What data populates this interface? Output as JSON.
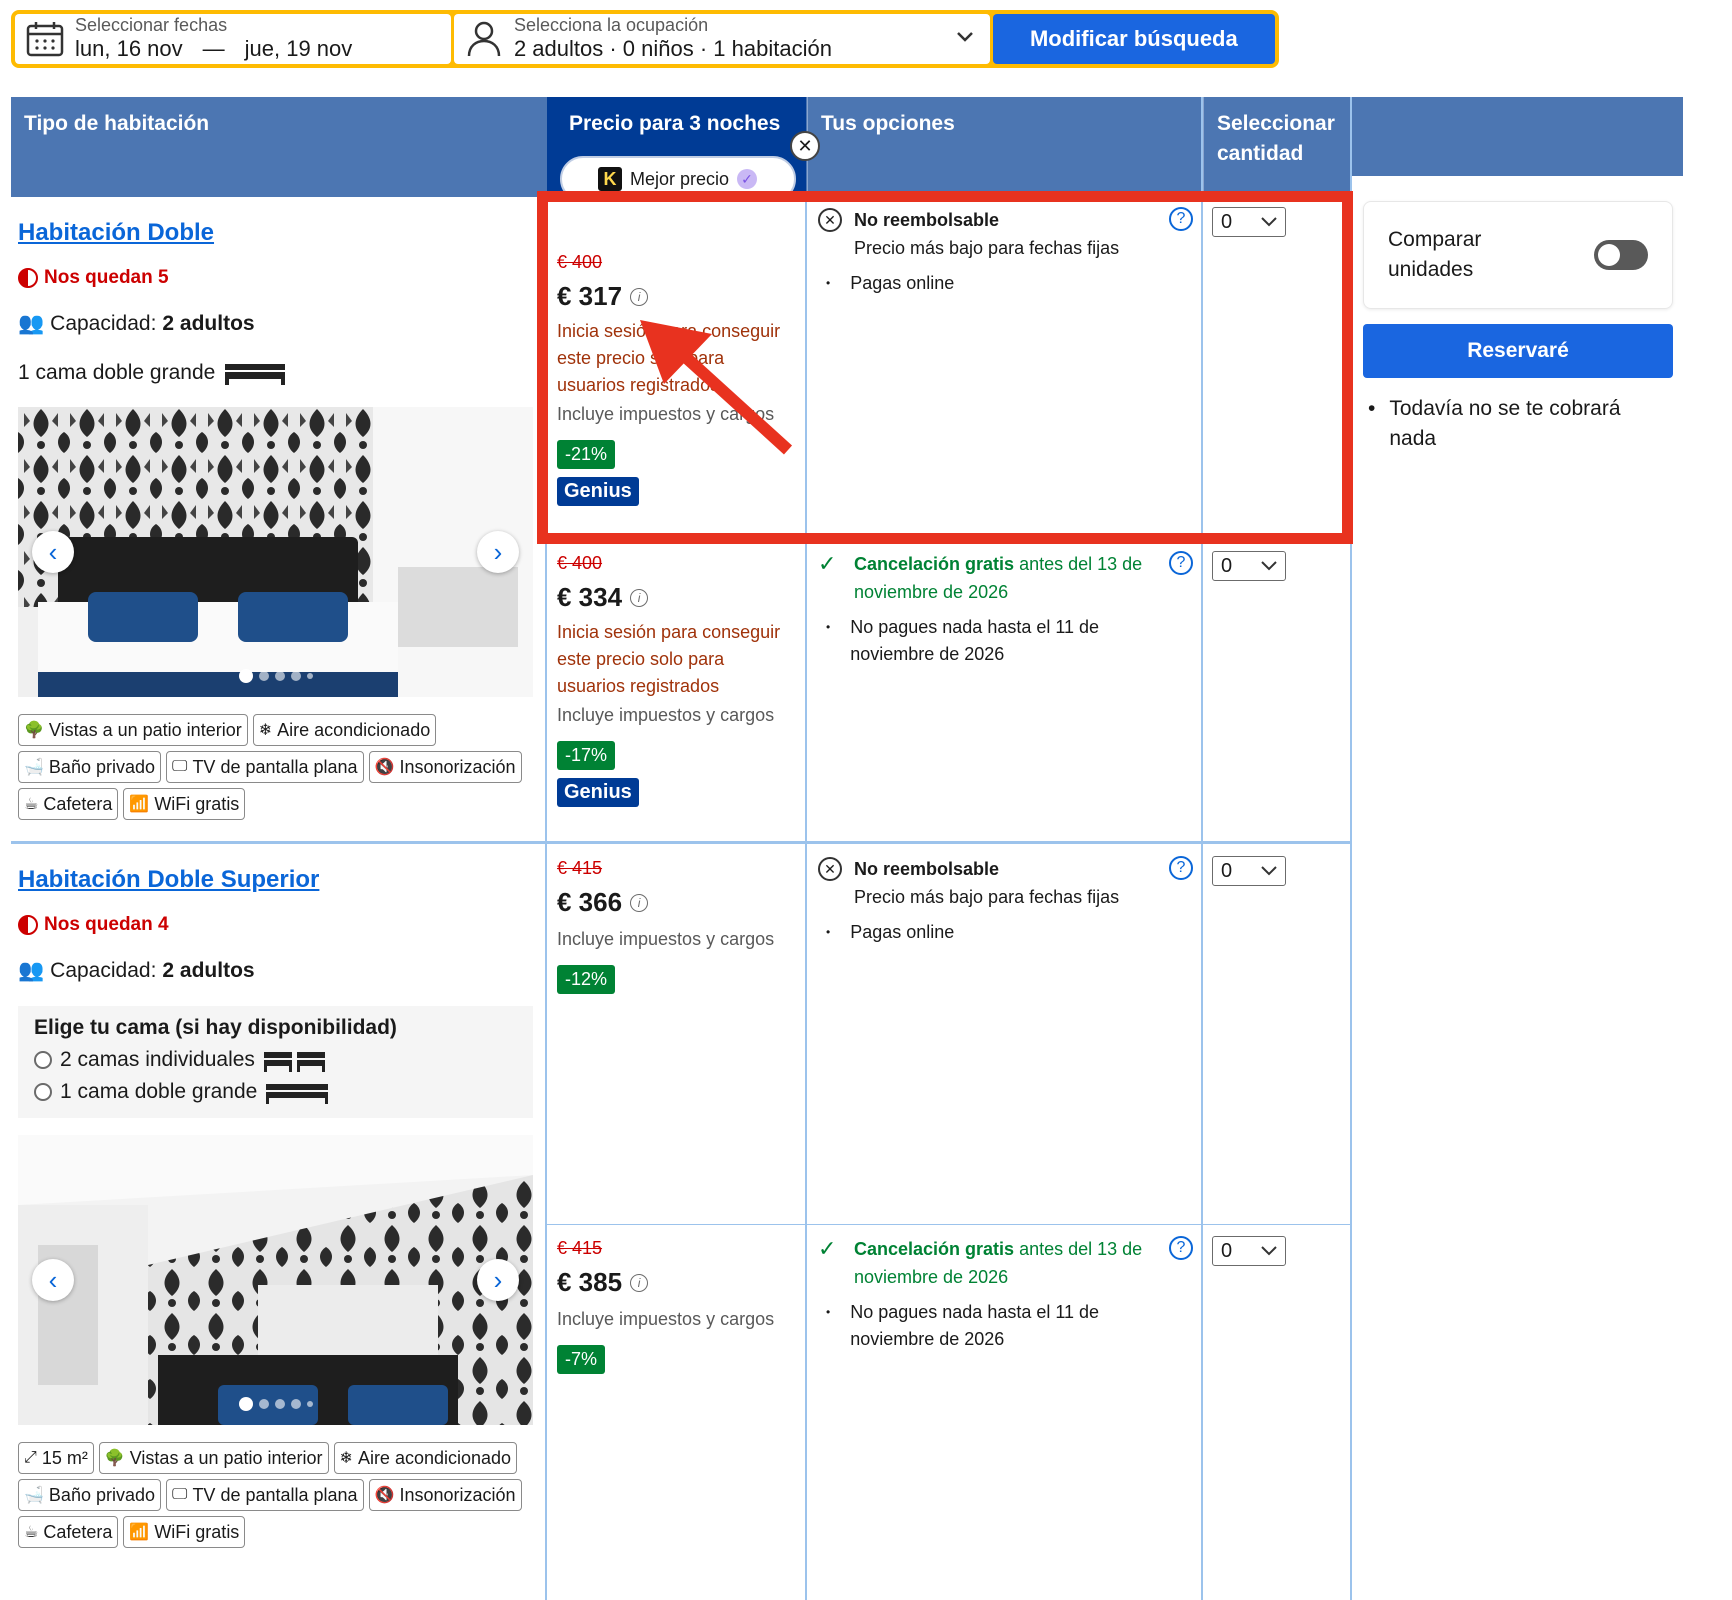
{
  "search": {
    "dates_label": "Seleccionar fechas",
    "checkin": "lun, 16 nov",
    "dash": "—",
    "checkout": "jue, 19 nov",
    "occupancy_label": "Selecciona la ocupación",
    "occupancy_value": "2 adultos · 0 niños · 1 habitación",
    "modify_button": "Modificar búsqueda"
  },
  "table_header": {
    "room_type": "Tipo de habitación",
    "price": "Precio para 3 noches",
    "options": "Tus opciones",
    "quantity": "Seleccionar cantidad"
  },
  "best_price": {
    "k_letter": "K",
    "label": "Mejor precio"
  },
  "rooms": [
    {
      "title": "Habitación Doble",
      "left": "Nos quedan 5",
      "capacity_label": "Capacidad:",
      "capacity_value": "2 adultos",
      "bed": "1 cama doble grande",
      "facilities": [
        "Vistas a un patio interior",
        "Aire acondicionado",
        "Baño privado",
        "TV de pantalla plana",
        "Insonorización",
        "Cafetera",
        "WiFi gratis"
      ]
    },
    {
      "title": "Habitación Doble Superior",
      "left": "Nos quedan 4",
      "capacity_label": "Capacidad:",
      "capacity_value": "2 adultos",
      "bed_choice_title": "Elige tu cama (si hay disponibilidad)",
      "bed_options": [
        "2 camas individuales",
        "1 cama doble grande"
      ],
      "facilities": [
        "15 m²",
        "Vistas a un patio interior",
        "Aire acondicionado",
        "Baño privado",
        "TV de pantalla plana",
        "Insonorización",
        "Cafetera",
        "WiFi gratis"
      ]
    }
  ],
  "offers": [
    {
      "old_price": "€ 400",
      "price": "€ 317",
      "login_note": "Inicia sesión para conseguir este precio solo para usuarios registrados",
      "taxes": "Incluye impuestos y cargos",
      "discount": "-21%",
      "genius": "Genius",
      "option_title": "No reembolsable",
      "option_sub": "Precio más bajo para fechas fijas",
      "bullet": "Pagas online",
      "qty": "0"
    },
    {
      "old_price": "€ 400",
      "price": "€ 334",
      "login_note": "Inicia sesión para conseguir este precio solo para usuarios registrados",
      "taxes": "Incluye impuestos y cargos",
      "discount": "-17%",
      "genius": "Genius",
      "option_title": "Cancelación gratis",
      "option_rest": " antes del 13 de noviembre de 2026",
      "bullet": "No pagues nada hasta el 11 de noviembre de 2026",
      "qty": "0"
    },
    {
      "old_price": "€ 415",
      "price": "€ 366",
      "taxes": "Incluye impuestos y cargos",
      "discount": "-12%",
      "option_title": "No reembolsable",
      "option_sub": "Precio más bajo para fechas fijas",
      "bullet": "Pagas online",
      "qty": "0"
    },
    {
      "old_price": "€ 415",
      "price": "€ 385",
      "taxes": "Incluye impuestos y cargos",
      "discount": "-7%",
      "option_title": "Cancelación gratis",
      "option_rest": " antes del 13 de noviembre de 2026",
      "bullet": "No pagues nada hasta el 11 de noviembre de 2026",
      "qty": "0"
    }
  ],
  "side": {
    "compare": "Comparar unidades",
    "reserve_button": "Reservaré",
    "note": "Todavía no se te cobrará nada"
  },
  "colors": {
    "header": "#4c76b2",
    "price_header": "#003b95",
    "button": "#1a66e0",
    "discount": "#008234",
    "annotation": "#e8321f"
  }
}
